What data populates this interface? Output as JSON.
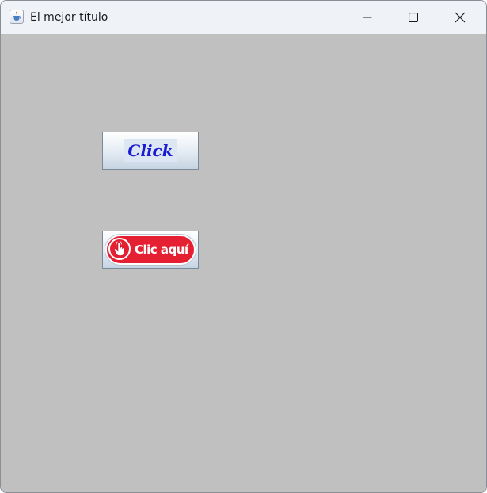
{
  "window": {
    "title": "El mejor título",
    "app_icon": "java-cup-icon",
    "controls": [
      "minimize-icon",
      "maximize-icon",
      "close-icon"
    ]
  },
  "content": {
    "background_color": "#c0c0c0",
    "buttons": [
      {
        "label": "Click",
        "text_color": "#1a1ad0"
      },
      {
        "label": "Clic aquí",
        "icon": "hand-pointer-icon",
        "pill_color": "#e52033"
      }
    ]
  }
}
